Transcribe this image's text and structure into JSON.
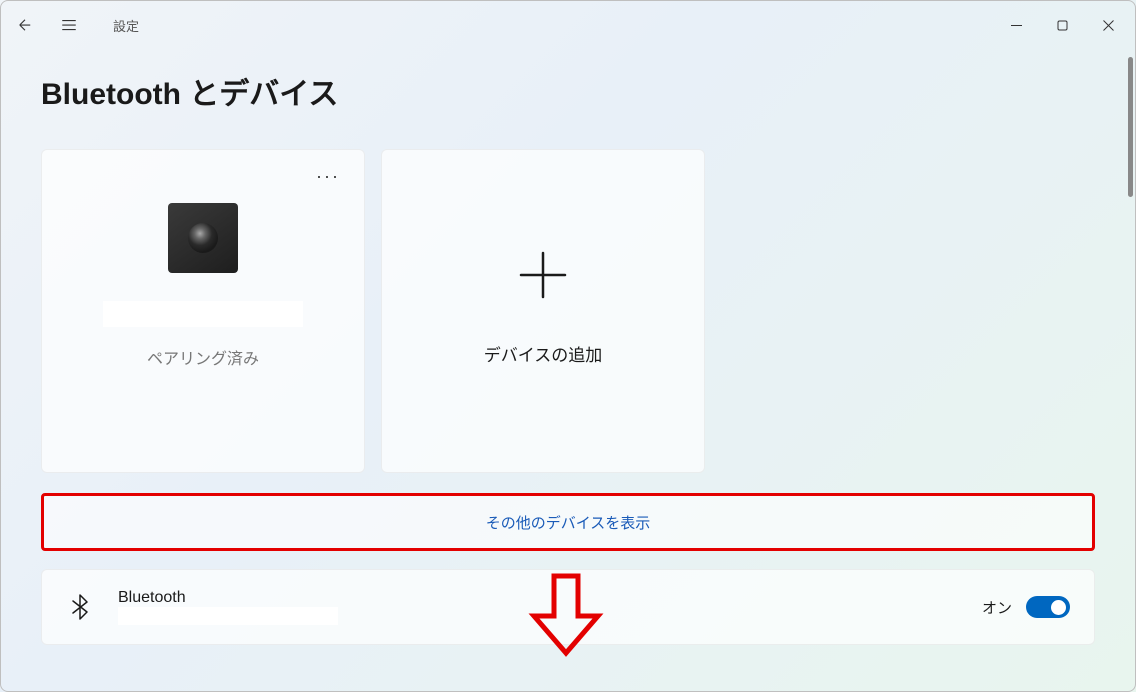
{
  "app": {
    "title": "設定"
  },
  "page": {
    "title": "Bluetooth とデバイス"
  },
  "device_tile": {
    "status": "ペアリング済み"
  },
  "add_tile": {
    "label": "デバイスの追加"
  },
  "show_more": {
    "label": "その他のデバイスを表示"
  },
  "bluetooth": {
    "label": "Bluetooth",
    "toggle_state": "オン"
  }
}
